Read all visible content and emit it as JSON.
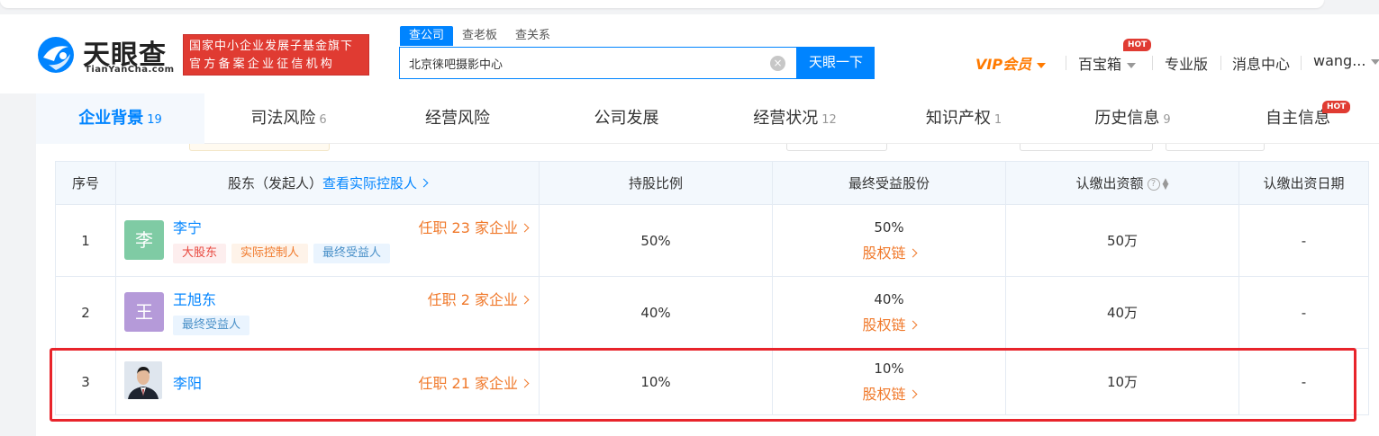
{
  "header": {
    "logo": {
      "name": "天眼查",
      "sub": "TianYanCha.com"
    },
    "badge": {
      "line1": "国家中小企业发展子基金旗下",
      "line2": "官方备案企业征信机构"
    },
    "search_tabs": [
      "查公司",
      "查老板",
      "查关系"
    ],
    "search_value": "北京徕吧摄影中心",
    "search_button": "天眼一下",
    "nav": {
      "vip": "VIP会员",
      "treasure": "百宝箱",
      "pro": "专业版",
      "messages": "消息中心",
      "user": "wang..."
    },
    "hot_label": "HOT"
  },
  "tabs": [
    {
      "label": "企业背景",
      "count": "19"
    },
    {
      "label": "司法风险",
      "count": "6"
    },
    {
      "label": "经营风险",
      "count": ""
    },
    {
      "label": "公司发展",
      "count": ""
    },
    {
      "label": "经营状况",
      "count": "12"
    },
    {
      "label": "知识产权",
      "count": "1"
    },
    {
      "label": "历史信息",
      "count": "9"
    },
    {
      "label": "自主信息",
      "count": ""
    }
  ],
  "table": {
    "headers": {
      "index": "序号",
      "holder": "股东（发起人）",
      "holder_link": "查看实际控股人",
      "ratio": "持股比例",
      "final": "最终受益股份",
      "capital": "认缴出资额",
      "date": "认缴出资日期"
    },
    "rows": [
      {
        "index": "1",
        "avatar_char": "李",
        "name": "李宁",
        "post": "任职 23 家企业",
        "tags": [
          "大股东",
          "实际控制人",
          "最终受益人"
        ],
        "ratio": "50%",
        "final_pct": "50%",
        "chain": "股权链",
        "capital": "50万",
        "date": "-"
      },
      {
        "index": "2",
        "avatar_char": "王",
        "name": "王旭东",
        "post": "任职 2 家企业",
        "tags": [
          "最终受益人"
        ],
        "ratio": "40%",
        "final_pct": "40%",
        "chain": "股权链",
        "capital": "40万",
        "date": "-"
      },
      {
        "index": "3",
        "avatar_char": "",
        "name": "李阳",
        "post": "任职 21 家企业",
        "tags": [],
        "ratio": "10%",
        "final_pct": "10%",
        "chain": "股权链",
        "capital": "10万",
        "date": "-"
      }
    ]
  },
  "colors": {
    "accent": "#0084ff",
    "orange": "#f0792b",
    "highlight": "#e8242b",
    "avatar1": "#7fcba4",
    "avatar2": "#b59ad9"
  }
}
